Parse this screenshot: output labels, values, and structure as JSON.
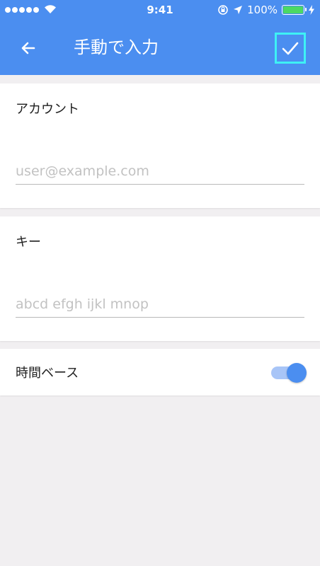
{
  "status_bar": {
    "time": "9:41",
    "battery": "100%",
    "battery_level": 1.0
  },
  "app_bar": {
    "title": "手動で入力",
    "back_icon": "arrow-left-icon",
    "confirm_icon": "check-icon"
  },
  "account": {
    "label": "アカウント",
    "placeholder": "user@example.com",
    "value": ""
  },
  "key": {
    "label": "キー",
    "placeholder": "abcd efgh ijkl mnop",
    "value": ""
  },
  "time_based": {
    "label": "時間ベース",
    "enabled": true
  },
  "colors": {
    "primary": "#4b8ef0",
    "toggle_track": "#a8c5f7",
    "focus_outline": "#3ef1f5",
    "battery": "#4cd964",
    "background": "#f1eff1"
  }
}
